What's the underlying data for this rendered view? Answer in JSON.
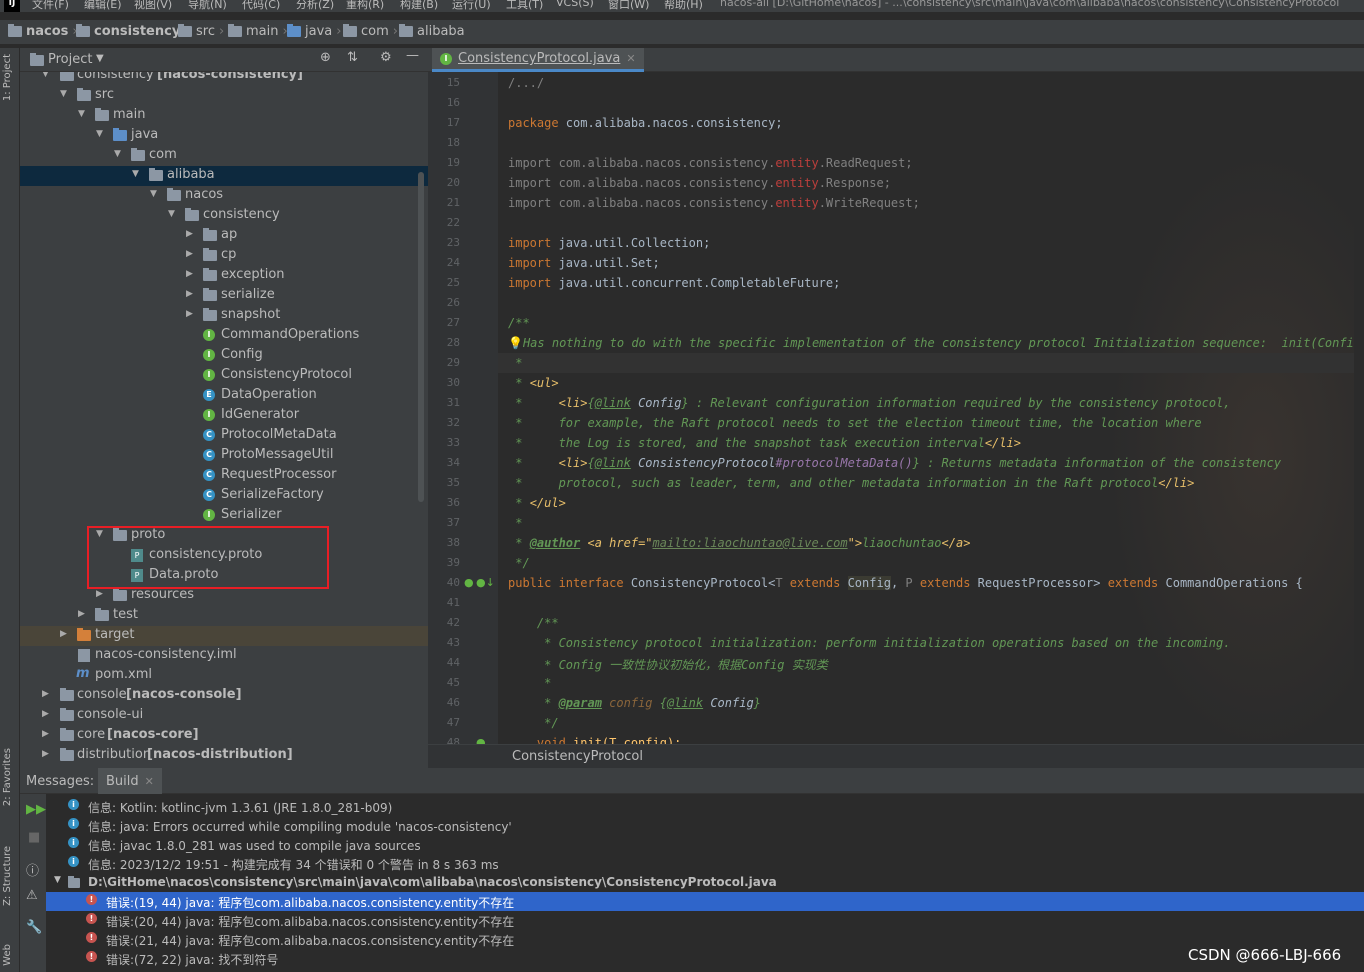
{
  "menu": {
    "logo": "IJ",
    "items": [
      "文件(F)",
      "编辑(E)",
      "视图(V)",
      "导航(N)",
      "代码(C)",
      "分析(Z)",
      "重构(R)",
      "构建(B)",
      "运行(U)",
      "工具(T)",
      "VCS(S)",
      "窗口(W)",
      "帮助(H)"
    ],
    "title": "nacos-all [D:\\GitHome\\nacos] - ...\\consistency\\src\\main\\java\\com\\alibaba\\nacos\\consistency\\ConsistencyProtocol"
  },
  "breadcrumbs": [
    "nacos",
    "consistency",
    "src",
    "main",
    "java",
    "com",
    "alibaba"
  ],
  "left_strip": {
    "project": "1: Project",
    "favorites": "2: Favorites",
    "structure": "Z: Structure",
    "web": "Web"
  },
  "project": {
    "title": "Project",
    "tree": [
      {
        "label": "consistency",
        "suffix": " [nacos-consistency]"
      },
      {
        "label": "src"
      },
      {
        "label": "main"
      },
      {
        "label": "java"
      },
      {
        "label": "com"
      },
      {
        "label": "alibaba"
      },
      {
        "label": "nacos"
      },
      {
        "label": "consistency"
      },
      {
        "label": "ap"
      },
      {
        "label": "cp"
      },
      {
        "label": "exception"
      },
      {
        "label": "serialize"
      },
      {
        "label": "snapshot"
      },
      {
        "label": "CommandOperations",
        "kind": "I"
      },
      {
        "label": "Config",
        "kind": "I"
      },
      {
        "label": "ConsistencyProtocol",
        "kind": "I"
      },
      {
        "label": "DataOperation",
        "kind": "E"
      },
      {
        "label": "IdGenerator",
        "kind": "I"
      },
      {
        "label": "ProtocolMetaData",
        "kind": "C"
      },
      {
        "label": "ProtoMessageUtil",
        "kind": "C"
      },
      {
        "label": "RequestProcessor",
        "kind": "C"
      },
      {
        "label": "SerializeFactory",
        "kind": "C"
      },
      {
        "label": "Serializer",
        "kind": "I"
      },
      {
        "label": "proto"
      },
      {
        "label": "consistency.proto"
      },
      {
        "label": "Data.proto"
      },
      {
        "label": "resources"
      },
      {
        "label": "test"
      },
      {
        "label": "target"
      },
      {
        "label": "nacos-consistency.iml"
      },
      {
        "label": "pom.xml"
      },
      {
        "label": "console",
        "suffix": " [nacos-console]"
      },
      {
        "label": "console-ui"
      },
      {
        "label": "core",
        "suffix": " [nacos-core]"
      },
      {
        "label": "distribution",
        "suffix": " [nacos-distribution]"
      }
    ]
  },
  "editor": {
    "tab": "ConsistencyProtocol.java",
    "line_numbers": [
      "15",
      "16",
      "17",
      "18",
      "19",
      "20",
      "21",
      "22",
      "23",
      "24",
      "25",
      "26",
      "27",
      "28",
      "29",
      "30",
      "31",
      "32",
      "33",
      "34",
      "35",
      "36",
      "37",
      "38",
      "39",
      "40",
      "41",
      "42",
      "43",
      "44",
      "45",
      "46",
      "47",
      "48"
    ],
    "code": {
      "l15": "/.../",
      "l17a": "package",
      "l17b": " com.alibaba.nacos.consistency;",
      "imp": "import",
      "l19a": " com.alibaba.nacos.consistency.",
      "l19b": "entity",
      "l19c": ".ReadRequest;",
      "l20c": ".Response;",
      "l21c": ".WriteRequest;",
      "l23": " java.util.Collection;",
      "l24": " java.util.Set;",
      "l25": " java.util.concurrent.CompletableFuture;",
      "l27": "/**",
      "l28": "Has nothing to do with the specific implementation of the consistency protocol Initialization sequence:  init(Config).",
      "l29": " *",
      "l30a": " * ",
      "l30b": "<ul>",
      "l31a": " *     ",
      "l31b": "<li>",
      "l31c": "{",
      "l31d": "@link",
      "l31e": " Config",
      "l31f": "} : Relevant configuration information required by the consistency protocol,",
      "l32": " *     for example, the Raft protocol needs to set the election timeout time, the location where",
      "l33a": " *     the Log is stored, and the snapshot task execution interval",
      "l33b": "</li>",
      "l34a": " *     ",
      "l34b": "<li>",
      "l34c": "{",
      "l34d": "@link",
      "l34e": " ConsistencyProtocol",
      "l34f": "#protocolMetaData()",
      "l34g": "} : Returns metadata information of the consistency",
      "l35a": " *     protocol, such as leader, term, and other metadata information in the Raft protocol",
      "l35b": "</li>",
      "l36a": " * ",
      "l36b": "</ul>",
      "l37": " *",
      "l38a": " * ",
      "l38b": "@author",
      "l38c": " ",
      "l38d": "<a href=\"",
      "l38e": "mailto:liaochuntao@live.com",
      "l38f": "\">",
      "l38g": "liaochuntao",
      "l38h": "</a>",
      "l39": " */",
      "l40a": "public interface",
      "l40b": " ConsistencyProtocol<",
      "l40c": "T",
      "l40d": " extends ",
      "l40e": "Config",
      "l40f": ", ",
      "l40g": "P",
      "l40h": " extends ",
      "l40i": "RequestProcessor> ",
      "l40j": "extends",
      "l40k": " CommandOperations {",
      "l42": "    /**",
      "l43": "     * Consistency protocol initialization: perform initialization operations based on the incoming.",
      "l44": "     * Config 一致性协议初始化，根据Config 实现类",
      "l45": "     *",
      "l46a": "     * ",
      "l46b": "@param",
      "l46c": " config ",
      "l46d": "{",
      "l46e": "@link",
      "l46f": " Config",
      "l46g": "}",
      "l47": "     */",
      "l48a": "    void ",
      "l48b": "init(T config);"
    },
    "structure_crumb": "ConsistencyProtocol"
  },
  "messages": {
    "label": "Messages:",
    "tab": "Build",
    "rows": [
      "信息: Kotlin: kotlinc-jvm 1.3.61 (JRE 1.8.0_281-b09)",
      "信息: java: Errors occurred while compiling module 'nacos-consistency'",
      "信息: javac 1.8.0_281 was used to compile java sources",
      "信息: 2023/12/2 19:51 - 构建完成有 34 个错误和 0 个警告 in 8 s 363 ms"
    ],
    "file": "D:\\GitHome\\nacos\\consistency\\src\\main\\java\\com\\alibaba\\nacos\\consistency\\ConsistencyProtocol.java",
    "errors": [
      "错误:(19, 44)  java: 程序包com.alibaba.nacos.consistency.entity不存在",
      "错误:(20, 44)  java: 程序包com.alibaba.nacos.consistency.entity不存在",
      "错误:(21, 44)  java: 程序包com.alibaba.nacos.consistency.entity不存在",
      "错误:(72, 22)  java: 找不到符号"
    ]
  },
  "watermark": "CSDN @666-LBJ-666",
  "colors": {
    "selection": "#2f65ca",
    "highlight_box": "#e81e25",
    "tab_underline": "#4a88c7"
  }
}
